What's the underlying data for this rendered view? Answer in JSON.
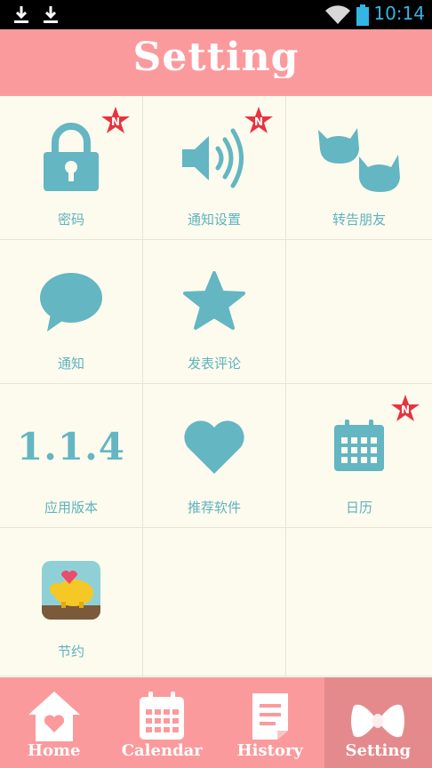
{
  "status_bar": {
    "time": "10:14"
  },
  "header": {
    "title": "Setting"
  },
  "grid": {
    "password": "密码",
    "notification_settings": "通知设置",
    "tell_friends": "转告朋友",
    "notifications": "通知",
    "write_review": "发表评论",
    "version_value": "1.1.4",
    "app_version": "应用版本",
    "recommended_apps": "推荐软件",
    "calendar": "日历",
    "savings": "节约",
    "badge_text": "N"
  },
  "tabs": {
    "home": "Home",
    "calendar": "Calendar",
    "history": "History",
    "setting": "Setting"
  },
  "colors": {
    "accent": "#63b6c2",
    "header": "#fb9a9c",
    "background": "#fcfbee",
    "badge": "#e8333f"
  }
}
